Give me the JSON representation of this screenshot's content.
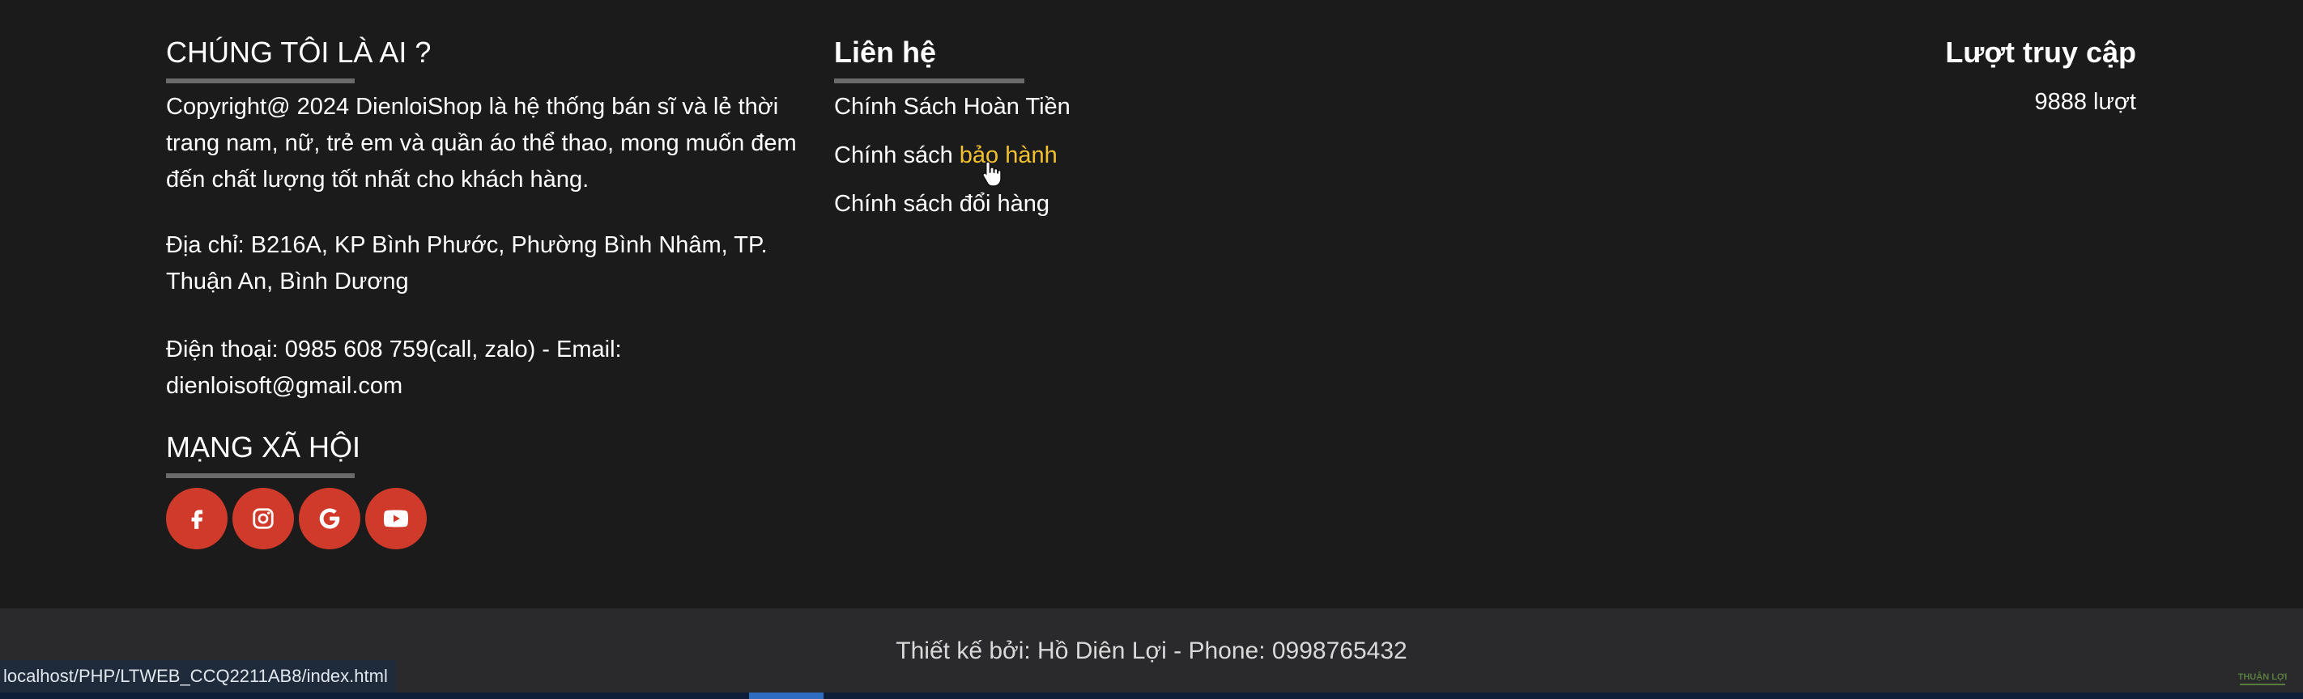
{
  "about": {
    "heading": "CHÚNG TÔI LÀ AI ?",
    "description": "Copyright@ 2024 DienloiShop là hệ thống bán sĩ và lẻ thời trang nam, nữ, trẻ em và quần áo thể thao, mong muốn đem đến chất lượng tốt nhất cho khách hàng.",
    "address": "Địa chỉ: B216A, KP Bình Phước, Phường Bình Nhâm, TP. Thuận An, Bình Dương",
    "phone_email": "Điện thoại: 0985 608 759(call, zalo) - Email: dienloisoft@gmail.com"
  },
  "social": {
    "heading": "MẠNG XÃ HỘI",
    "icons": [
      "facebook-icon",
      "instagram-icon",
      "google-icon",
      "youtube-icon"
    ],
    "button_color": "#d03a2a"
  },
  "contact": {
    "heading": "Liên hệ",
    "links": [
      {
        "label": "Chính Sách Hoàn Tiền"
      },
      {
        "label_plain": "Chính sách ",
        "label_hover": "bảo hành"
      },
      {
        "label": "Chính sách đổi hàng"
      }
    ],
    "hover_color": "#f2c12e"
  },
  "visits": {
    "heading": "Lượt truy cập",
    "count": "9888 lượt"
  },
  "footer": {
    "credit": "Thiết kế bởi: Hồ Diên Lợi - Phone: 0998765432"
  },
  "status_bar": {
    "url": "localhost/PHP/LTWEB_CCQ2211AB8/index.html"
  },
  "watermark": {
    "text": "THUẬN LỢI"
  }
}
